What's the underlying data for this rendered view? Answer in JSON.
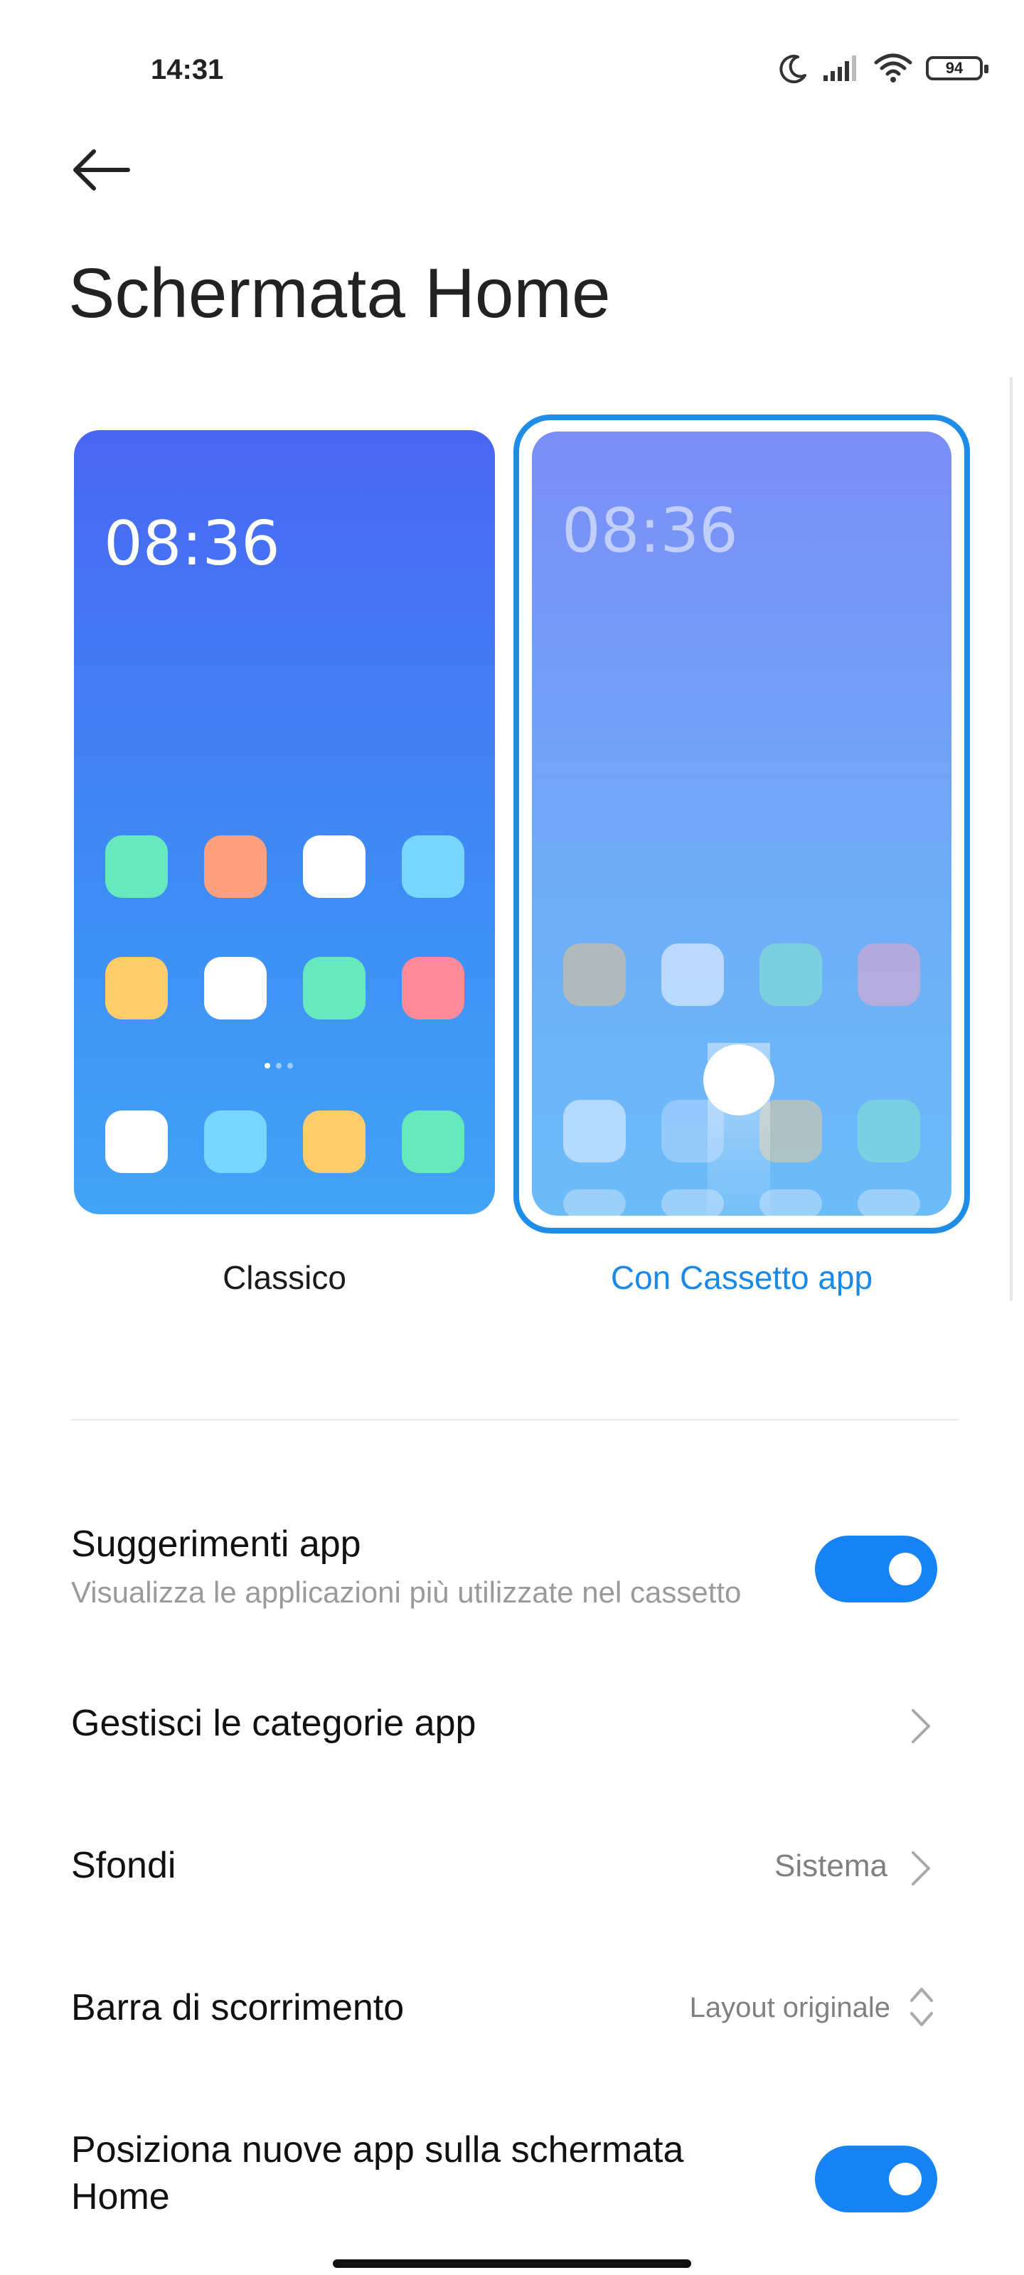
{
  "status_bar": {
    "time": "14:31",
    "battery": "94"
  },
  "page": {
    "title": "Schermata Home"
  },
  "previews": {
    "classic": {
      "clock": "08:36",
      "label": "Classico"
    },
    "drawer": {
      "clock": "08:36",
      "label": "Con Cassetto app"
    }
  },
  "settings": {
    "suggestions": {
      "title": "Suggerimenti app",
      "subtitle": "Visualizza le applicazioni più utilizzate nel cassetto",
      "enabled": true
    },
    "categories": {
      "title": "Gestisci le categorie app"
    },
    "wallpapers": {
      "title": "Sfondi",
      "value": "Sistema"
    },
    "scrollbar": {
      "title": "Barra di scorrimento",
      "value": "Layout originale"
    },
    "place_new_apps": {
      "title_line1": "Posiziona nuove app sulla schermata",
      "title_line2": "Home",
      "enabled": true
    }
  },
  "colors": {
    "accent": "#1683f5",
    "selected_label": "#1a8ae6"
  },
  "icons": [
    "moon-icon",
    "signal-icon",
    "wifi-icon",
    "battery-icon",
    "back-arrow-icon",
    "chevron-right-icon",
    "up-down-chevron-icon"
  ]
}
